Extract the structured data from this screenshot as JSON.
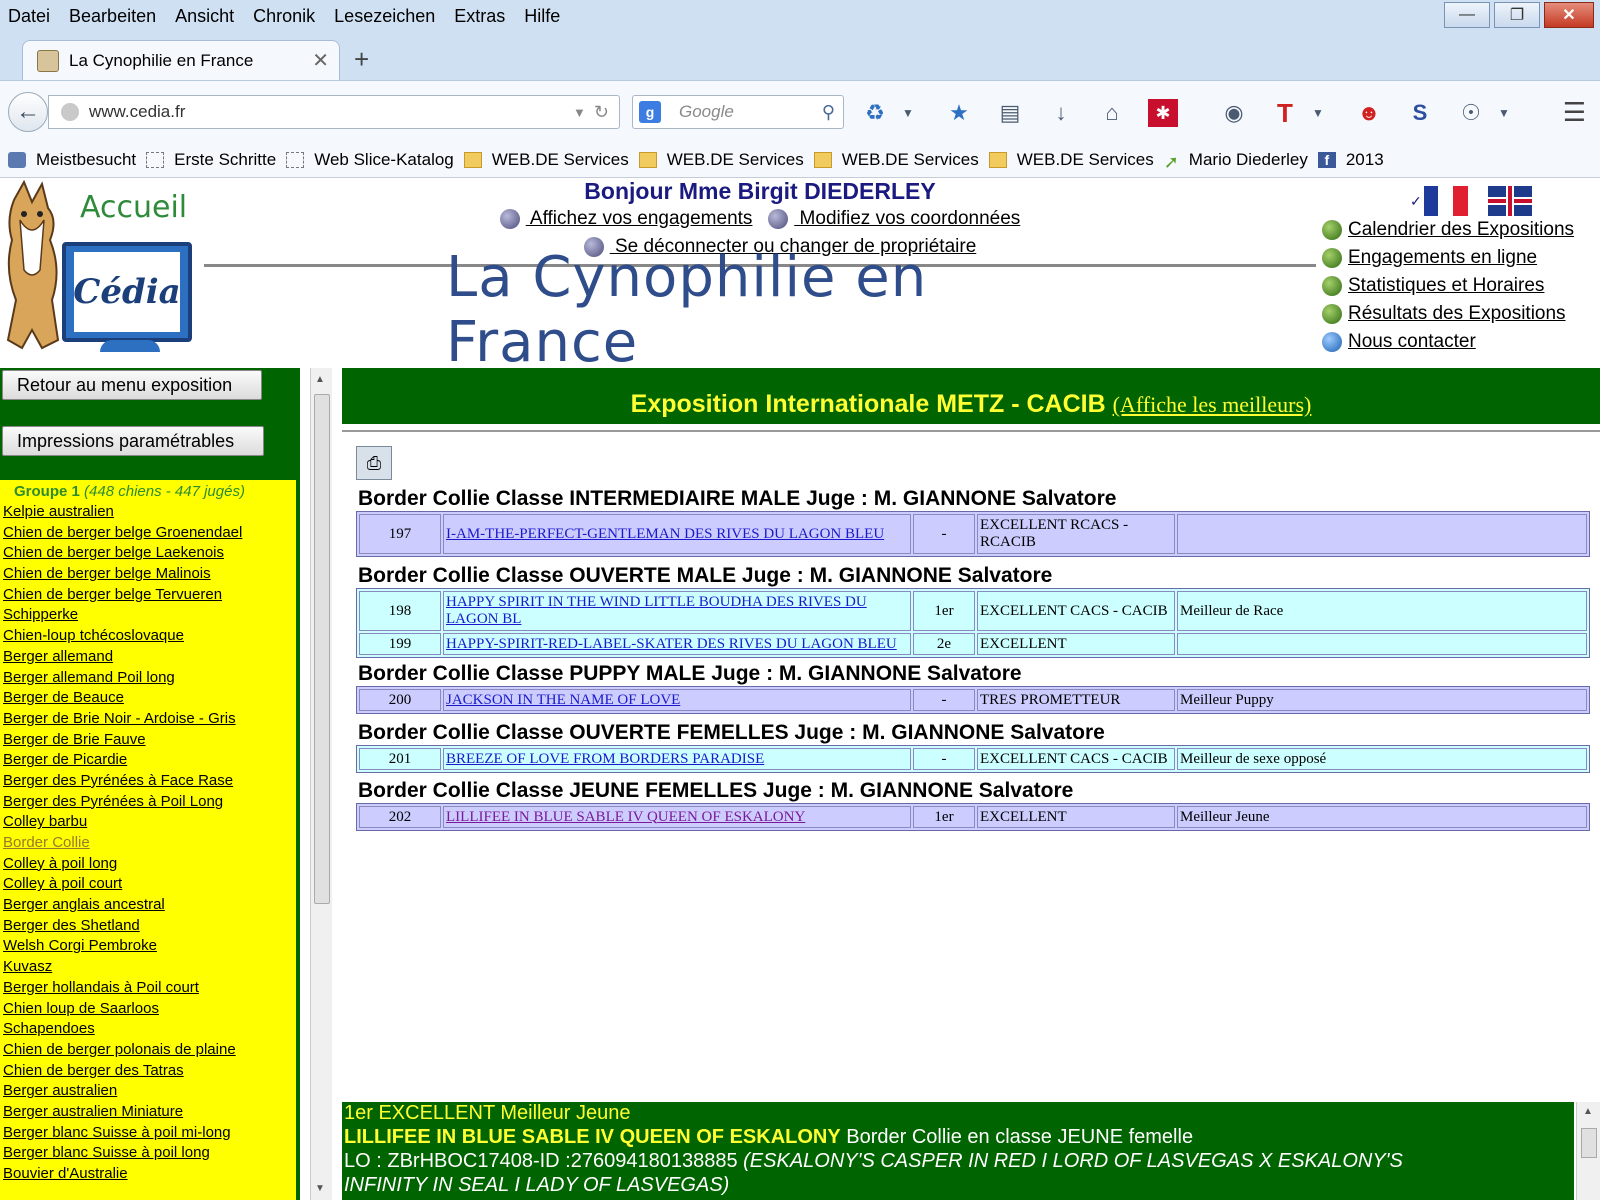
{
  "browser": {
    "menu": [
      "Datei",
      "Bearbeiten",
      "Ansicht",
      "Chronik",
      "Lesezeichen",
      "Extras",
      "Hilfe"
    ],
    "tab_title": "La Cynophilie en France",
    "url": "www.cedia.fr",
    "search_placeholder": "Google",
    "bookmarks": [
      {
        "label": "Meistbesucht",
        "icon": "search-icon"
      },
      {
        "label": "Erste Schritte",
        "icon": "dashed-page-icon"
      },
      {
        "label": "Web Slice-Katalog",
        "icon": "dashed-page-icon"
      },
      {
        "label": "WEB.DE Services",
        "icon": "folder-icon"
      },
      {
        "label": "WEB.DE Services",
        "icon": "folder-icon"
      },
      {
        "label": "WEB.DE Services",
        "icon": "folder-icon"
      },
      {
        "label": "WEB.DE Services",
        "icon": "folder-icon"
      },
      {
        "label": "Mario  Diederley",
        "icon": "arrow-icon"
      },
      {
        "label": "2013",
        "icon": "facebook-icon"
      }
    ]
  },
  "header": {
    "accueil": "Accueil",
    "logo_text": "Cédia",
    "greeting": "Bonjour Mme Birgit DIEDERLEY",
    "link_engagements": " Affichez vos engagements",
    "link_coordonnees": " Modifiez vos coordonnées",
    "link_deconnect": " Se déconnecter ou changer de propriétaire",
    "site_title": "La Cynophilie en France",
    "right_links": [
      "Calendrier des Expositions",
      "Engagements en ligne",
      "Statistiques et Horaires",
      "Résultats des Expositions",
      "Nous contacter"
    ]
  },
  "sidebar": {
    "btn_retour": "Retour au menu exposition",
    "btn_impressions": "Impressions paramétrables",
    "group_label": "Groupe 1",
    "group_stats": "(448 chiens - 447 jugés)",
    "breeds": [
      "Kelpie australien",
      "Chien de berger belge Groenendael",
      "Chien de berger belge Laekenois",
      "Chien de berger belge Malinois",
      "Chien de berger belge Tervueren",
      "Schipperke",
      "Chien-loup tchécoslovaque",
      "Berger allemand",
      "Berger allemand Poil long",
      "Berger de Beauce",
      "Berger de Brie Noir - Ardoise - Gris",
      "Berger de Brie Fauve",
      "Berger de Picardie",
      "Berger des Pyrénées à Face Rase",
      "Berger des Pyrénées à Poil Long",
      "Colley barbu",
      "Border Collie",
      "Colley à poil long",
      "Colley à poil court",
      "Berger anglais ancestral",
      "Berger des Shetland",
      "Welsh Corgi Pembroke",
      "Kuvasz",
      "Berger hollandais à Poil court",
      "Chien loup de Saarloos",
      "Schapendoes",
      "Chien de berger polonais de plaine",
      "Chien de berger des Tatras",
      "Berger australien",
      "Berger australien Miniature",
      "Berger blanc Suisse à poil mi-long",
      "Berger blanc Suisse à poil long",
      "Bouvier d'Australie"
    ],
    "active_breed": "Border Collie"
  },
  "content": {
    "title": "Exposition Internationale METZ - CACIB",
    "title_link": "(Affiche les meilleurs)",
    "sections": [
      {
        "heading": "Border Collie Classe INTERMEDIAIRE  MALE Juge : M. GIANNONE Salvatore",
        "color": "lav",
        "rows": [
          {
            "num": "197",
            "name": "I-AM-THE-PERFECT-GENTLEMAN DES RIVES DU LAGON BLEU",
            "place": "-",
            "qual": "EXCELLENT RCACS - RCACIB",
            "award": ""
          }
        ]
      },
      {
        "heading": "Border Collie Classe OUVERTE  MALE Juge : M. GIANNONE Salvatore",
        "color": "cyan",
        "rows": [
          {
            "num": "198",
            "name": "HAPPY SPIRIT IN THE WIND LITTLE BOUDHA DES RIVES DU LAGON BL",
            "place": "1er",
            "qual": "EXCELLENT CACS - CACIB",
            "award": "Meilleur de Race"
          },
          {
            "num": "199",
            "name": "HAPPY-SPIRIT-RED-LABEL-SKATER DES RIVES DU LAGON BLEU",
            "place": "2e",
            "qual": "EXCELLENT",
            "award": ""
          }
        ]
      },
      {
        "heading": "Border Collie Classe PUPPY  MALE Juge : M. GIANNONE Salvatore",
        "color": "lav",
        "rows": [
          {
            "num": "200",
            "name": "JACKSON IN THE NAME OF LOVE",
            "place": "-",
            "qual": "TRES PROMETTEUR",
            "award": "  Meilleur Puppy"
          }
        ]
      },
      {
        "heading": "Border Collie Classe OUVERTE  FEMELLES Juge : M. GIANNONE Salvatore",
        "color": "cyan",
        "rows": [
          {
            "num": "201",
            "name": "BREEZE OF LOVE FROM BORDERS PARADISE",
            "place": "-",
            "qual": "EXCELLENT CACS - CACIB",
            "award": "Meilleur de sexe opposé"
          }
        ]
      },
      {
        "heading": "Border Collie Classe JEUNE  FEMELLES Juge : M. GIANNONE Salvatore",
        "color": "lav",
        "rows": [
          {
            "num": "202",
            "name": "LILLIFEE IN BLUE SABLE IV QUEEN OF ESKALONY",
            "place": "1er",
            "qual": "EXCELLENT",
            "award": "  Meilleur Jeune"
          }
        ]
      }
    ]
  },
  "bottom": {
    "line1": "1er EXCELLENT Meilleur Jeune",
    "dog_name": "LILLIFEE IN BLUE SABLE IV QUEEN OF ESKALONY",
    "line2_rest": " Border Collie en classe JEUNE femelle",
    "line3_id": "LO : ZBrHBOC17408-ID :276094180138885 ",
    "line3_parents": "(ESKALONY'S CASPER IN RED I LORD OF LASVEGAS X ESKALONY'S",
    "line4_parents": "INFINITY IN SEAL I LADY OF LASVEGAS)"
  },
  "colors": {
    "site_green": "#006400",
    "sidebar_yellow": "#ffff00",
    "title_yellow": "#ffff33",
    "row_lavender": "#ccccff",
    "row_cyan": "#ccffff"
  }
}
